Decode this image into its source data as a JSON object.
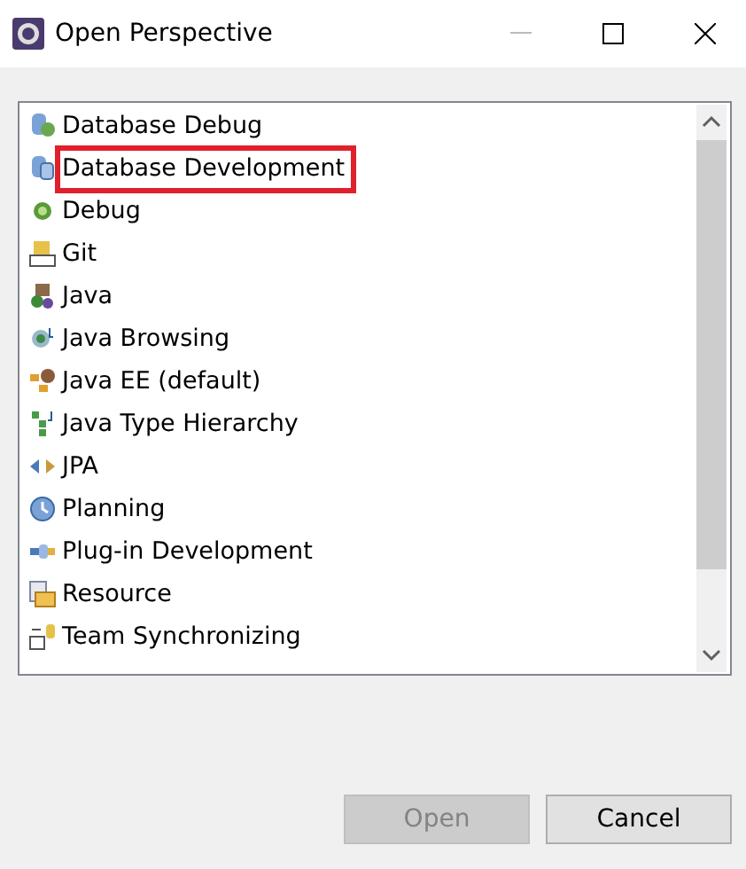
{
  "window": {
    "title": "Open Perspective"
  },
  "perspectives": [
    {
      "label": "Database Debug",
      "highlighted": false
    },
    {
      "label": "Database Development",
      "highlighted": true
    },
    {
      "label": "Debug",
      "highlighted": false
    },
    {
      "label": "Git",
      "highlighted": false
    },
    {
      "label": "Java",
      "highlighted": false
    },
    {
      "label": "Java Browsing",
      "highlighted": false
    },
    {
      "label": "Java EE (default)",
      "highlighted": false
    },
    {
      "label": "Java Type Hierarchy",
      "highlighted": false
    },
    {
      "label": "JPA",
      "highlighted": false
    },
    {
      "label": "Planning",
      "highlighted": false
    },
    {
      "label": "Plug-in Development",
      "highlighted": false
    },
    {
      "label": "Resource",
      "highlighted": false
    },
    {
      "label": "Team Synchronizing",
      "highlighted": false
    }
  ],
  "buttons": [
    {
      "label": "Open",
      "disabled": true
    },
    {
      "label": "Cancel",
      "disabled": false
    }
  ]
}
